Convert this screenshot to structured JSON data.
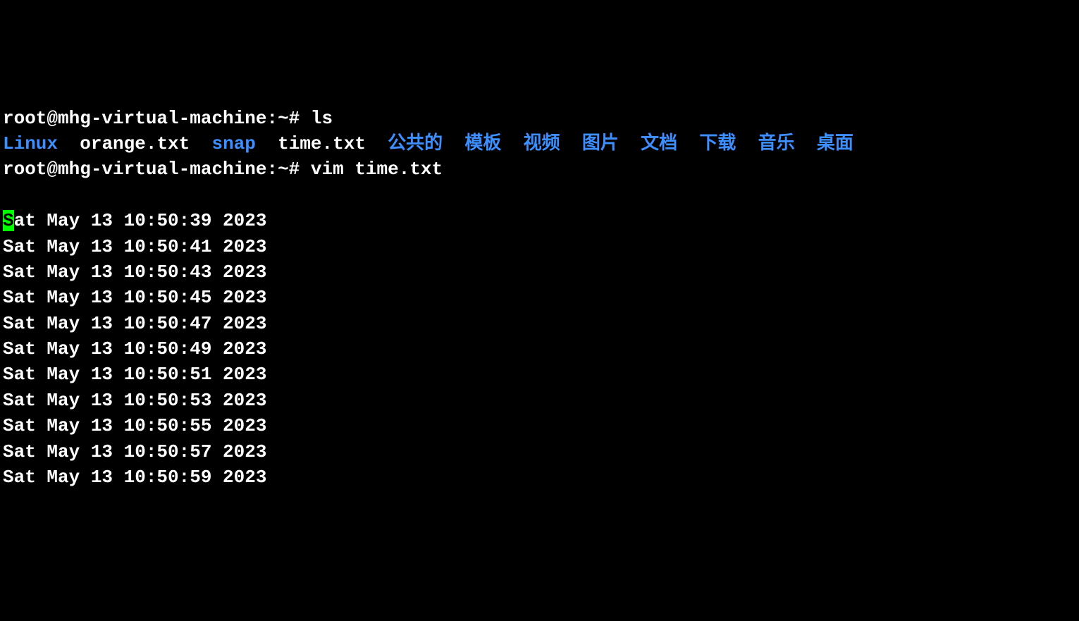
{
  "prompt1": {
    "prefix": "root@mhg-virtual-machine:~# ",
    "command": "ls"
  },
  "ls_output": {
    "entries": [
      {
        "name": "Linux",
        "type": "dir"
      },
      {
        "name": "orange.txt",
        "type": "file"
      },
      {
        "name": "snap",
        "type": "dir"
      },
      {
        "name": "time.txt",
        "type": "file"
      },
      {
        "name": "公共的",
        "type": "dir"
      },
      {
        "name": "模板",
        "type": "dir"
      },
      {
        "name": "视频",
        "type": "dir"
      },
      {
        "name": "图片",
        "type": "dir"
      },
      {
        "name": "文档",
        "type": "dir"
      },
      {
        "name": "下载",
        "type": "dir"
      },
      {
        "name": "音乐",
        "type": "dir"
      },
      {
        "name": "桌面",
        "type": "dir"
      }
    ]
  },
  "prompt2": {
    "prefix": "root@mhg-virtual-machine:~# ",
    "command": "vim time.txt"
  },
  "file_content": {
    "cursor_char": "S",
    "first_line_rest": "at May 13 10:50:39 2023",
    "lines": [
      "Sat May 13 10:50:41 2023",
      "Sat May 13 10:50:43 2023",
      "Sat May 13 10:50:45 2023",
      "Sat May 13 10:50:47 2023",
      "Sat May 13 10:50:49 2023",
      "Sat May 13 10:50:51 2023",
      "Sat May 13 10:50:53 2023",
      "Sat May 13 10:50:55 2023",
      "Sat May 13 10:50:57 2023",
      "Sat May 13 10:50:59 2023"
    ]
  }
}
